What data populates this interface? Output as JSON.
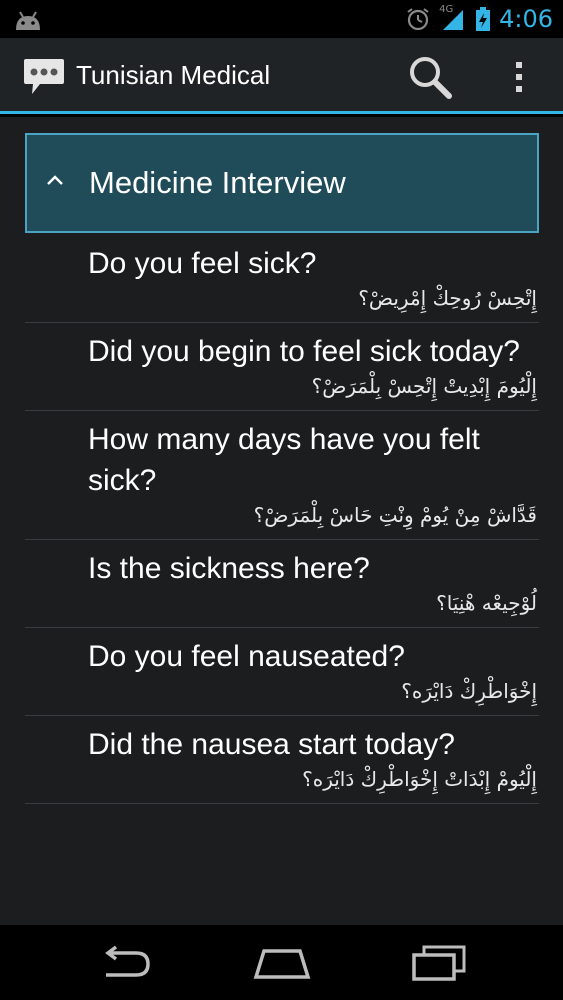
{
  "status_bar": {
    "time": "4:06",
    "network": "4G",
    "icons": [
      "android-icon",
      "alarm-icon",
      "signal-icon",
      "battery-icon"
    ]
  },
  "action_bar": {
    "title": "Tunisian Medical",
    "icons": [
      "chat-bubble-icon",
      "search-icon",
      "overflow-menu-icon"
    ]
  },
  "group": {
    "title": "Medicine Interview",
    "expanded": true
  },
  "items": [
    {
      "english": "Do you feel sick?",
      "arabic": "إِتْحِسْ رُوحِكْ إِمْرِيضْ؟"
    },
    {
      "english": "Did you begin to feel sick today?",
      "arabic": "إِلْيُومَ إِبْدِيتْ إِتْحِسْ بِلْمَرَضْ؟"
    },
    {
      "english": "How many days have you felt sick?",
      "arabic": "قَدَّاشْ مِنْ يُومْ وِنْتِ حَاسْ بِلْمَرَضْ؟"
    },
    {
      "english": "Is the sickness here?",
      "arabic": "لُوْجِيعْه هْنِيَا؟"
    },
    {
      "english": "Do you feel nauseated?",
      "arabic": "إِخْوَاطْرِكْ دَايْرَه؟"
    },
    {
      "english": "Did the nausea start today?",
      "arabic": "إِلْيُومْ إِبْدَاتْ إِخْوَاطْرِكْ دَايْرَه؟"
    }
  ],
  "nav_bar": {
    "icons": [
      "back-icon",
      "home-icon",
      "recent-apps-icon"
    ]
  },
  "colors": {
    "accent": "#33b5e5",
    "header_bg": "#204c5a",
    "header_border": "#4aa3c2",
    "list_bg": "#1b1d1f"
  }
}
